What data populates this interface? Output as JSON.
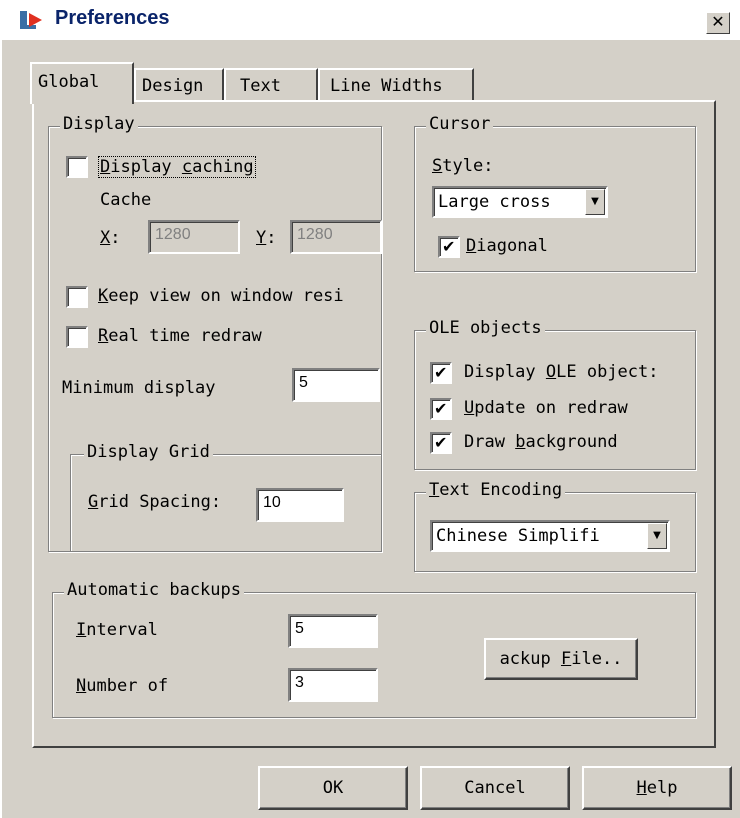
{
  "window": {
    "title": "Preferences",
    "close_symbol": "✕"
  },
  "tabs": [
    {
      "label": "Global",
      "active": true
    },
    {
      "label": "Design"
    },
    {
      "label": "Text"
    },
    {
      "label": "Line Widths"
    }
  ],
  "display": {
    "group_label": "Display",
    "display_caching": {
      "pre": "",
      "key": "D",
      "post": "isplay ",
      "key2": "c",
      "post2": "aching",
      "checked": false
    },
    "cache_label": "Cache",
    "x_label_key": "X",
    "x_label_post": ":",
    "x_value": "1280",
    "y_label_key": "Y",
    "y_label_post": ":",
    "y_value": "1280",
    "keep_view": {
      "key": "K",
      "post": "eep view on window resi",
      "checked": false
    },
    "real_time": {
      "key": "R",
      "post": "eal time redraw",
      "checked": false
    },
    "min_display_label": "Minimum display",
    "min_display_value": "5",
    "grid": {
      "group_label": "Display Grid",
      "spacing_key": "G",
      "spacing_post": "rid Spacing:",
      "spacing_value": "10"
    }
  },
  "cursor": {
    "group_label": "Cursor",
    "style_key": "S",
    "style_post": "tyle:",
    "style_value": "Large cross",
    "diagonal": {
      "key": "D",
      "post": "iagonal",
      "checked": true
    }
  },
  "ole": {
    "group_label": "OLE objects",
    "display_ole": {
      "pre": "Display ",
      "key": "O",
      "post": "LE object:",
      "checked": true
    },
    "update_redraw": {
      "key": "U",
      "post": "pdate on redraw",
      "checked": true
    },
    "draw_background": {
      "pre": "Draw ",
      "key": "b",
      "post": "ackground",
      "checked": true
    }
  },
  "encoding": {
    "group_key": "T",
    "group_post": "ext Encoding",
    "value": "Chinese Simplifi"
  },
  "backups": {
    "group_label": "Automatic backups",
    "interval_key": "I",
    "interval_post": "nterval",
    "interval_value": "5",
    "number_key": "N",
    "number_post": "umber of",
    "number_value": "3",
    "backup_btn_pre": "ackup ",
    "backup_btn_key": "F",
    "backup_btn_post": "ile.."
  },
  "buttons": {
    "ok": "OK",
    "cancel": "Cancel",
    "help_key": "H",
    "help_post": "elp"
  },
  "colors": {
    "title_text": "#0a246a",
    "face": "#d4d0c8",
    "icon_red": "#e03020",
    "icon_blue": "#3a6ea5"
  }
}
